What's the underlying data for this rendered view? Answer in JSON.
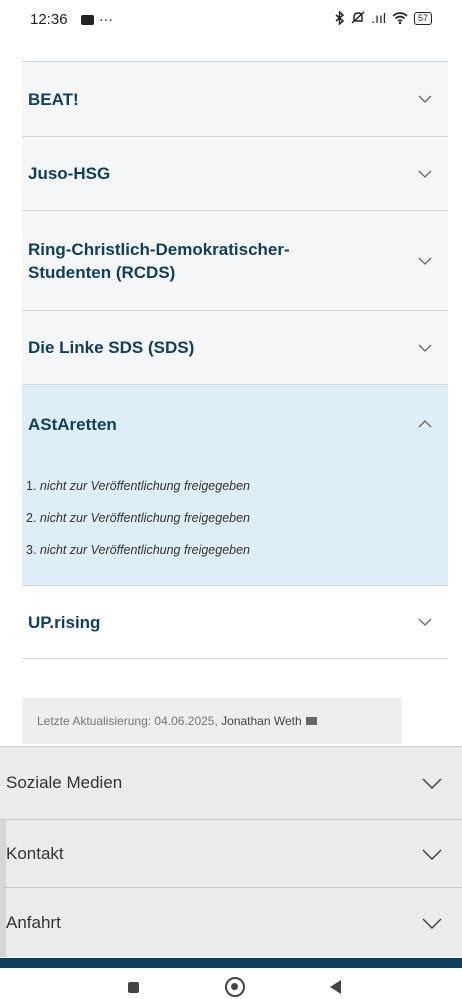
{
  "status_bar": {
    "time": "12:36",
    "overflow_dots": "···",
    "signal_text": ".ııl",
    "battery": "57",
    "icons": [
      "youtube-icon",
      "bluetooth-icon",
      "mute-icon",
      "signal-icon",
      "wifi-icon",
      "battery-icon"
    ]
  },
  "accordion": {
    "items": [
      {
        "title": "BEAT!",
        "open": false
      },
      {
        "title": "Juso-HSG",
        "open": false
      },
      {
        "title": "Ring-Christlich-Demokratischer-Studenten (RCDS)",
        "open": false
      },
      {
        "title": "Die Linke SDS (SDS)",
        "open": false
      },
      {
        "title": "AStAretten",
        "open": true,
        "list": [
          {
            "num": "1.",
            "text": "nicht zur Veröffentlichung freigegeben"
          },
          {
            "num": "2.",
            "text": "nicht zur Veröffentlichung freigegeben"
          },
          {
            "num": "3.",
            "text": "nicht zur Veröffentlichung freigegeben"
          }
        ]
      },
      {
        "title": "UP.rising",
        "open": false
      }
    ]
  },
  "last_update": {
    "prefix": "Letzte Aktualisierung: 04.06.2025,",
    "author": "Jonathan Weth"
  },
  "footer": {
    "items": [
      {
        "label": "Soziale Medien"
      },
      {
        "label": "Kontakt"
      },
      {
        "label": "Anfahrt"
      }
    ]
  },
  "colors": {
    "heading": "#0f3f5a",
    "open_bg": "#ddeef7",
    "closed_bg": "#f5f6f7",
    "footer_bg": "#ebebeb",
    "footer_bar": "#0f3f5a"
  }
}
